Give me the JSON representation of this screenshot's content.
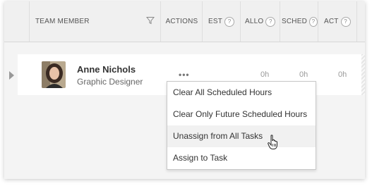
{
  "header": {
    "team_member": "TEAM MEMBER",
    "actions": "ACTIONS",
    "est": "EST",
    "allo": "ALLO",
    "sched": "SCHED",
    "act": "ACT",
    "help_glyph": "?"
  },
  "member": {
    "name": "Anne Nichols",
    "role": "Graphic Designer",
    "actions_glyph": "•••",
    "allo_hours": "0h",
    "sched_hours": "0h",
    "act_hours": "0h"
  },
  "menu": {
    "items": [
      {
        "label": "Clear All Scheduled Hours"
      },
      {
        "label": "Clear Only Future Scheduled Hours"
      },
      {
        "label": "Unassign from All Tasks"
      },
      {
        "label": "Assign to Task"
      }
    ],
    "hovered_item": "Unassign from All Tasks"
  },
  "icons": {
    "filter": "filter-icon",
    "help": "help-icon",
    "expand": "caret-right-icon",
    "cursor": "hand-pointer-icon"
  },
  "colors": {
    "header_bg": "#f0f0f0",
    "row_bg": "#ffffff",
    "hover_bg": "#f1f1f1",
    "text": "#333333"
  }
}
